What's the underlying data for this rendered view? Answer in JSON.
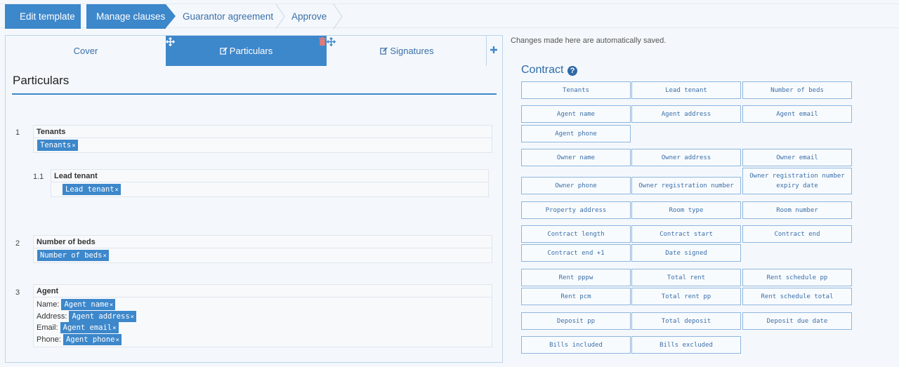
{
  "breadcrumb": [
    "Edit template",
    "Manage clauses",
    "Guarantor agreement",
    "Approve"
  ],
  "tabs": {
    "cover": "Cover",
    "particulars": "Particulars",
    "signatures": "Signatures"
  },
  "icons": {
    "move": "move-icon",
    "trash": "trash-icon",
    "plus": "plus-icon",
    "edit": "edit-icon",
    "help": "help-icon",
    "remove": "remove-token-icon"
  },
  "colors": {
    "accent": "#3d87cb",
    "trash": "#e07a7a",
    "title": "#2f6aa8"
  },
  "section_title": "Particulars",
  "clauses": {
    "c1": {
      "num": "1",
      "title": "Tenants",
      "token": "Tenants"
    },
    "c11": {
      "num": "1.1",
      "title": "Lead tenant",
      "token": "Lead tenant"
    },
    "c2": {
      "num": "2",
      "title": "Number of beds",
      "token": "Number of beds"
    },
    "c3": {
      "num": "3",
      "title": "Agent",
      "name_label": "Name:",
      "name_token": "Agent name",
      "address_label": "Address:",
      "address_token": "Agent address",
      "email_label": "Email:",
      "email_token": "Agent email",
      "phone_label": "Phone:",
      "phone_token": "Agent phone"
    }
  },
  "token_remove": "×",
  "autosave_note": "Changes made here are automatically saved.",
  "variables_title": "Contract",
  "help_glyph": "?",
  "variables": [
    "Tenants",
    "Lead tenant",
    "Number of beds",
    "Agent name",
    "Agent address",
    "Agent email",
    "Agent phone",
    "Owner name",
    "Owner address",
    "Owner email",
    "Owner phone",
    "Owner registration number",
    "Owner registration number expiry date",
    "Property address",
    "Room type",
    "Room number",
    "Contract length",
    "Contract start",
    "Contract end",
    "Contract end +1",
    "Date signed",
    "Rent pppw",
    "Total rent",
    "Rent schedule pp",
    "Rent pcm",
    "Total rent pp",
    "Rent schedule total",
    "Deposit pp",
    "Total deposit",
    "Deposit due date",
    "Bills included",
    "Bills excluded"
  ]
}
